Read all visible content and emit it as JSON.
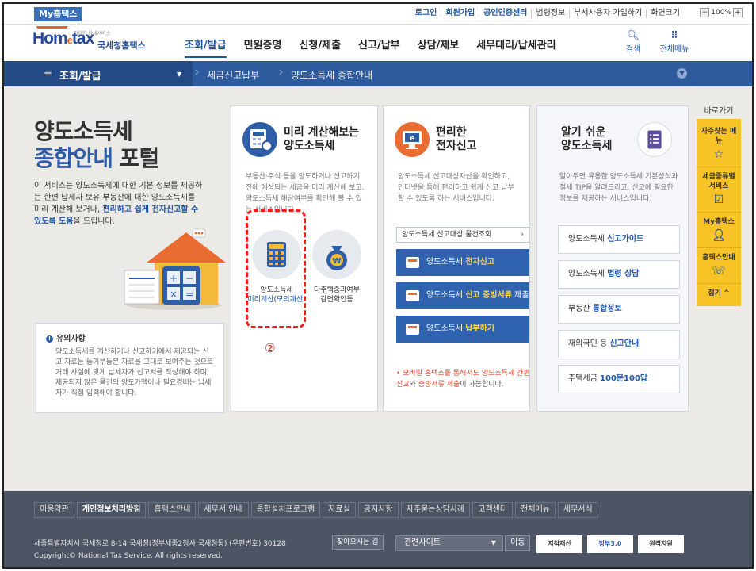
{
  "topbar": {
    "my_hometax": "My홈택스",
    "links": [
      "로그인",
      "회원가입",
      "공인인증센터",
      "범령정보",
      "부서사용자 가입하기",
      "화면크기"
    ],
    "zoom_minus": "−",
    "zoom_value": "100%",
    "zoom_plus": "+"
  },
  "header": {
    "logo_small": "안녕한 납세서비스",
    "logo_main": "Hom",
    "logo_accent": "e",
    "logo_tail": "tax",
    "logo_kr": "국세청홈택스",
    "nav": [
      "조회/발급",
      "민원증명",
      "신청/제출",
      "신고/납부",
      "상담/제보",
      "세무대리/납세관리"
    ],
    "search": "검색",
    "all_menu": "전체메뉴"
  },
  "breadcrumb": {
    "menu_label": "조회/발급",
    "items": [
      "세금신고납부",
      "양도소득세 종합안내"
    ]
  },
  "hero": {
    "title_line1": "양도소득세",
    "title_line2_blue": "종합안내",
    "title_line2_rest": " 포털",
    "desc_a": "이 서비스는 양도소득세에 대한 기본 정보를 제공하는 한편 납세자 보유 부동산에 대한 양도소득세를 미리 계산해 보거나, ",
    "desc_hl": "편리하고 쉽게 전자신고할 수 있도록 도움",
    "desc_b": "을 드립니다."
  },
  "notice": {
    "title": "유의사항",
    "body": "양도소득세를 계산하거나 신고하기에서 제공되는 신고 자료는 등기부등본 자료를 그대로 보여주는 것으로 거래 사실에 맞게 납세자가 신고서를 작성해야 하며, 제공되지 않은 물건의 양도가액이나 필요경비는 납세자가 직접 입력해야 합니다."
  },
  "card1": {
    "title_1": "미리 계산해보는",
    "title_2": "양도소득세",
    "desc": "부동산·주식 등을 양도하거나 신고하기 전에 예상되는 세금을 미리 계산해 보고, 양도소득세 해당여부를 확인해 볼 수 있는 서비스입니다.",
    "svc1_line1": "양도소득세",
    "svc1_line2": "미리계산(모의계산)",
    "svc2_line1": "다주택중과여부",
    "svc2_line2": "감면확인등",
    "marker": "②"
  },
  "card2": {
    "title_1": "편리한",
    "title_2": "전자신고",
    "desc": "양도소득세 신고대상자산을 확인하고, 인터넷을 통해 편리하고 쉽게 신고 납부할 수 있도록 하는 서비스입니다.",
    "lookup": "양도소득세 신고대상 물건조회",
    "btn1_a": "양도소득세 ",
    "btn1_b": "전자신고",
    "btn2_a": "양도소득세 ",
    "btn2_b": "신고 증빙서류",
    "btn2_c": " 제출",
    "btn3_a": "양도소득세 ",
    "btn3_b": "납부하기",
    "note_a": "• 모바일 홈택스를 통해서도 ",
    "note_red": "양도소득세 간편신고",
    "note_b": "와 ",
    "note_red2": "증빙서류 제출",
    "note_c": "이 가능합니다."
  },
  "card3": {
    "title_1": "알기 쉬운",
    "title_2": "양도소득세",
    "desc": "알아두면 유용한 양도소득세 기본상식과 절세 TIP을 알려드리고, 신고에 필요한 정보를 제공하는 서비스입니다.",
    "guides": [
      {
        "a": "양도소득세 ",
        "b": "신고가이드"
      },
      {
        "a": "양도소득세 ",
        "b": "법령 상담"
      },
      {
        "a": "부동산 ",
        "b": "통합정보"
      },
      {
        "a": "재외국민 등 ",
        "b": "신고안내"
      },
      {
        "a": "주택세금 ",
        "b": "100문100답"
      }
    ]
  },
  "quick": {
    "title": "바로가기",
    "items": [
      "자주찾는 메뉴",
      "세금종류별 서비스",
      "My홈택스",
      "홈택스안내"
    ],
    "close": "접기 ^"
  },
  "footer": {
    "links": [
      "이용약관",
      "개인정보처리방침",
      "홈택스안내",
      "세무서 안내",
      "통합설치프로그램",
      "자료실",
      "공지사항",
      "자주묻는상담사례",
      "고객센터",
      "전체메뉴",
      "세무서식"
    ],
    "address": "세종특별자치시 국세청로 8-14 국세청(정부세종2청사 국세청동) (우편번호) 30128",
    "directions": "찾아오시는 길",
    "copyright": "Copyright© National Tax Service. All rights reserved.",
    "related": "관련사이트",
    "go": "이동",
    "banner1": "지적재산",
    "banner2": "정부3.0",
    "banner3": "원격지원"
  },
  "colors": {
    "brand_blue": "#2e5ea8",
    "nav_bar": "#2e5b9e",
    "accent_orange": "#e96d33",
    "quick_yellow": "#f7c326",
    "footer": "#4d5564",
    "highlight_red": "#ff1a1a"
  }
}
